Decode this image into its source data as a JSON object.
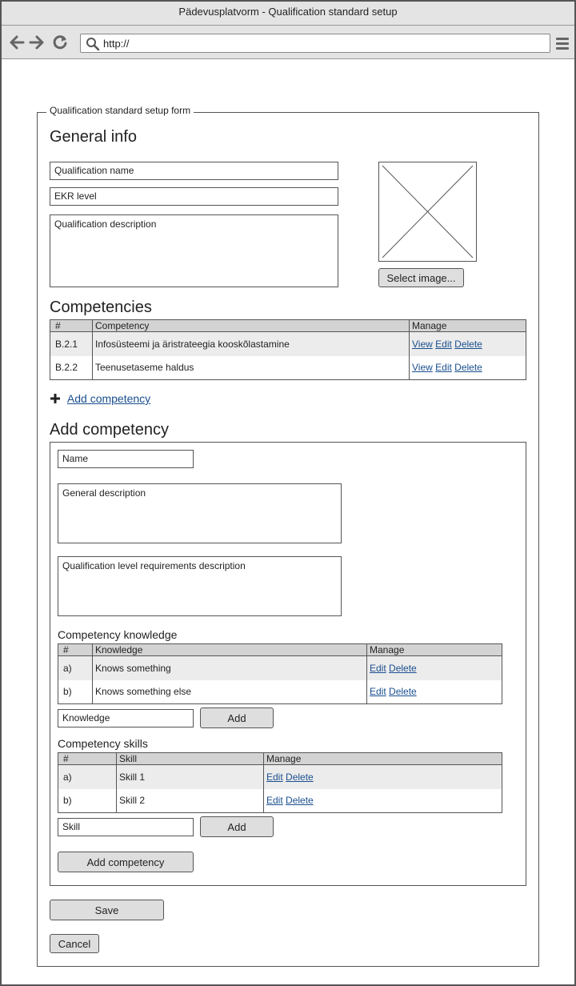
{
  "window": {
    "title": "Pädevusplatvorm - Qualification standard setup"
  },
  "browser": {
    "url": "http://"
  },
  "form": {
    "legend": "Qualification standard setup form",
    "general_heading": "General info",
    "qualification_name_placeholder": "Qualification name",
    "ekr_level_placeholder": "EKR level",
    "description_placeholder": "Qualification description",
    "select_image_label": "Select image..."
  },
  "competencies": {
    "heading": "Competencies",
    "columns": [
      "#",
      "Competency",
      "Manage"
    ],
    "rows": [
      {
        "id": "B.2.1",
        "name": "Infosüsteemi ja äristrateegia kooskõlastamine",
        "actions": [
          "View",
          "Edit",
          "Delete"
        ]
      },
      {
        "id": "B.2.2",
        "name": "Teenusetaseme haldus",
        "actions": [
          "View",
          "Edit",
          "Delete"
        ]
      }
    ],
    "add_link_label": "Add competency"
  },
  "add_competency": {
    "heading": "Add competency",
    "name_placeholder": "Name",
    "general_description_placeholder": "General description",
    "level_requirements_placeholder": "Qualification level requirements description",
    "knowledge": {
      "heading": "Competency knowledge",
      "columns": [
        "#",
        "Knowledge",
        "Manage"
      ],
      "rows": [
        {
          "id": "a)",
          "name": "Knows something",
          "actions": [
            "Edit",
            "Delete"
          ]
        },
        {
          "id": "b)",
          "name": "Knows something else",
          "actions": [
            "Edit",
            "Delete"
          ]
        }
      ],
      "input_placeholder": "Knowledge",
      "add_label": "Add"
    },
    "skills": {
      "heading": "Competency skills",
      "columns": [
        "#",
        "Skill",
        "Manage"
      ],
      "rows": [
        {
          "id": "a)",
          "name": "Skill 1",
          "actions": [
            "Edit",
            "Delete"
          ]
        },
        {
          "id": "b)",
          "name": "Skill 2",
          "actions": [
            "Edit",
            "Delete"
          ]
        }
      ],
      "input_placeholder": "Skill",
      "add_label": "Add"
    },
    "submit_label": "Add competency"
  },
  "actions": {
    "save_label": "Save",
    "cancel_label": "Cancel"
  }
}
